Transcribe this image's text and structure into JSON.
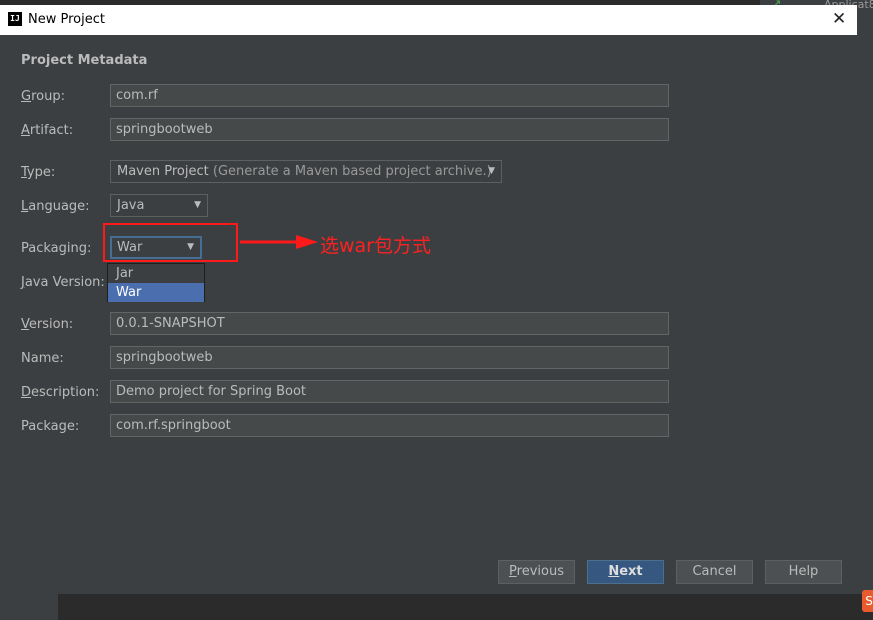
{
  "background": {
    "tab_text": "Applicat8",
    "badge": "S"
  },
  "window": {
    "title": "New Project",
    "app_icon": "IJ"
  },
  "section_title": "Project Metadata",
  "fields": {
    "group": {
      "label": "Group:",
      "value": "com.rf"
    },
    "artifact": {
      "label": "Artifact:",
      "value": "springbootweb"
    },
    "type": {
      "label": "Type:",
      "value": "Maven Project",
      "hint": "(Generate a Maven based project archive.)"
    },
    "language": {
      "label": "Language:",
      "value": "Java"
    },
    "packaging": {
      "label": "Packaging:",
      "value": "War",
      "options": [
        "Jar",
        "War"
      ],
      "selected": "War"
    },
    "java_version": {
      "label": "Java Version:"
    },
    "version": {
      "label": "Version:",
      "value": "0.0.1-SNAPSHOT"
    },
    "name": {
      "label": "Name:",
      "value": "springbootweb"
    },
    "description": {
      "label": "Description:",
      "value": "Demo project for Spring Boot"
    },
    "package": {
      "label": "Package:",
      "value": "com.rf.springboot"
    }
  },
  "annotation": {
    "text": "选war包方式",
    "color": "#ff2020"
  },
  "buttons": {
    "previous": "Previous",
    "next": "Next",
    "cancel": "Cancel",
    "help": "Help"
  },
  "colors": {
    "dialog_bg": "#3c3f41",
    "field_bg": "#45494a",
    "selection": "#4b6eaf",
    "primary_button": "#365880"
  }
}
